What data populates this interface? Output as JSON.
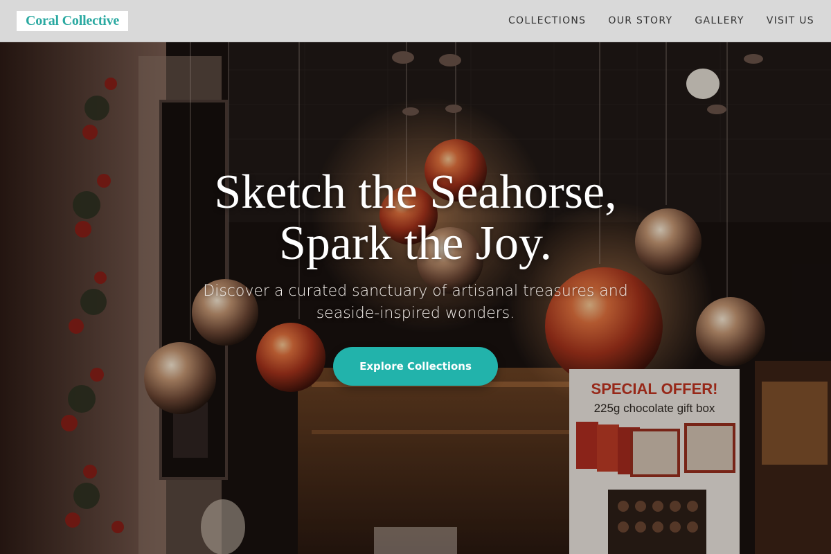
{
  "header": {
    "logo": "Coral Collective",
    "nav": [
      {
        "label": "COLLECTIONS"
      },
      {
        "label": "OUR STORY"
      },
      {
        "label": "GALLERY"
      },
      {
        "label": "VISIT US"
      }
    ]
  },
  "hero": {
    "title_line1": "Sketch the Seahorse,",
    "title_line2": "Spark the Joy.",
    "subtitle": "Discover a curated sanctuary of artisanal treasures and seaside-inspired wonders.",
    "cta_label": "Explore Collections",
    "background_image": "shop-window-with-christmas-ornaments",
    "sign_line1": "SPECIAL OFFER!",
    "sign_line2": "225g chocolate gift box"
  },
  "colors": {
    "accent": "#22b3ab",
    "logo_text": "#2aa9a1",
    "header_bg": "#d9d9d9",
    "nav_text": "#333333"
  }
}
